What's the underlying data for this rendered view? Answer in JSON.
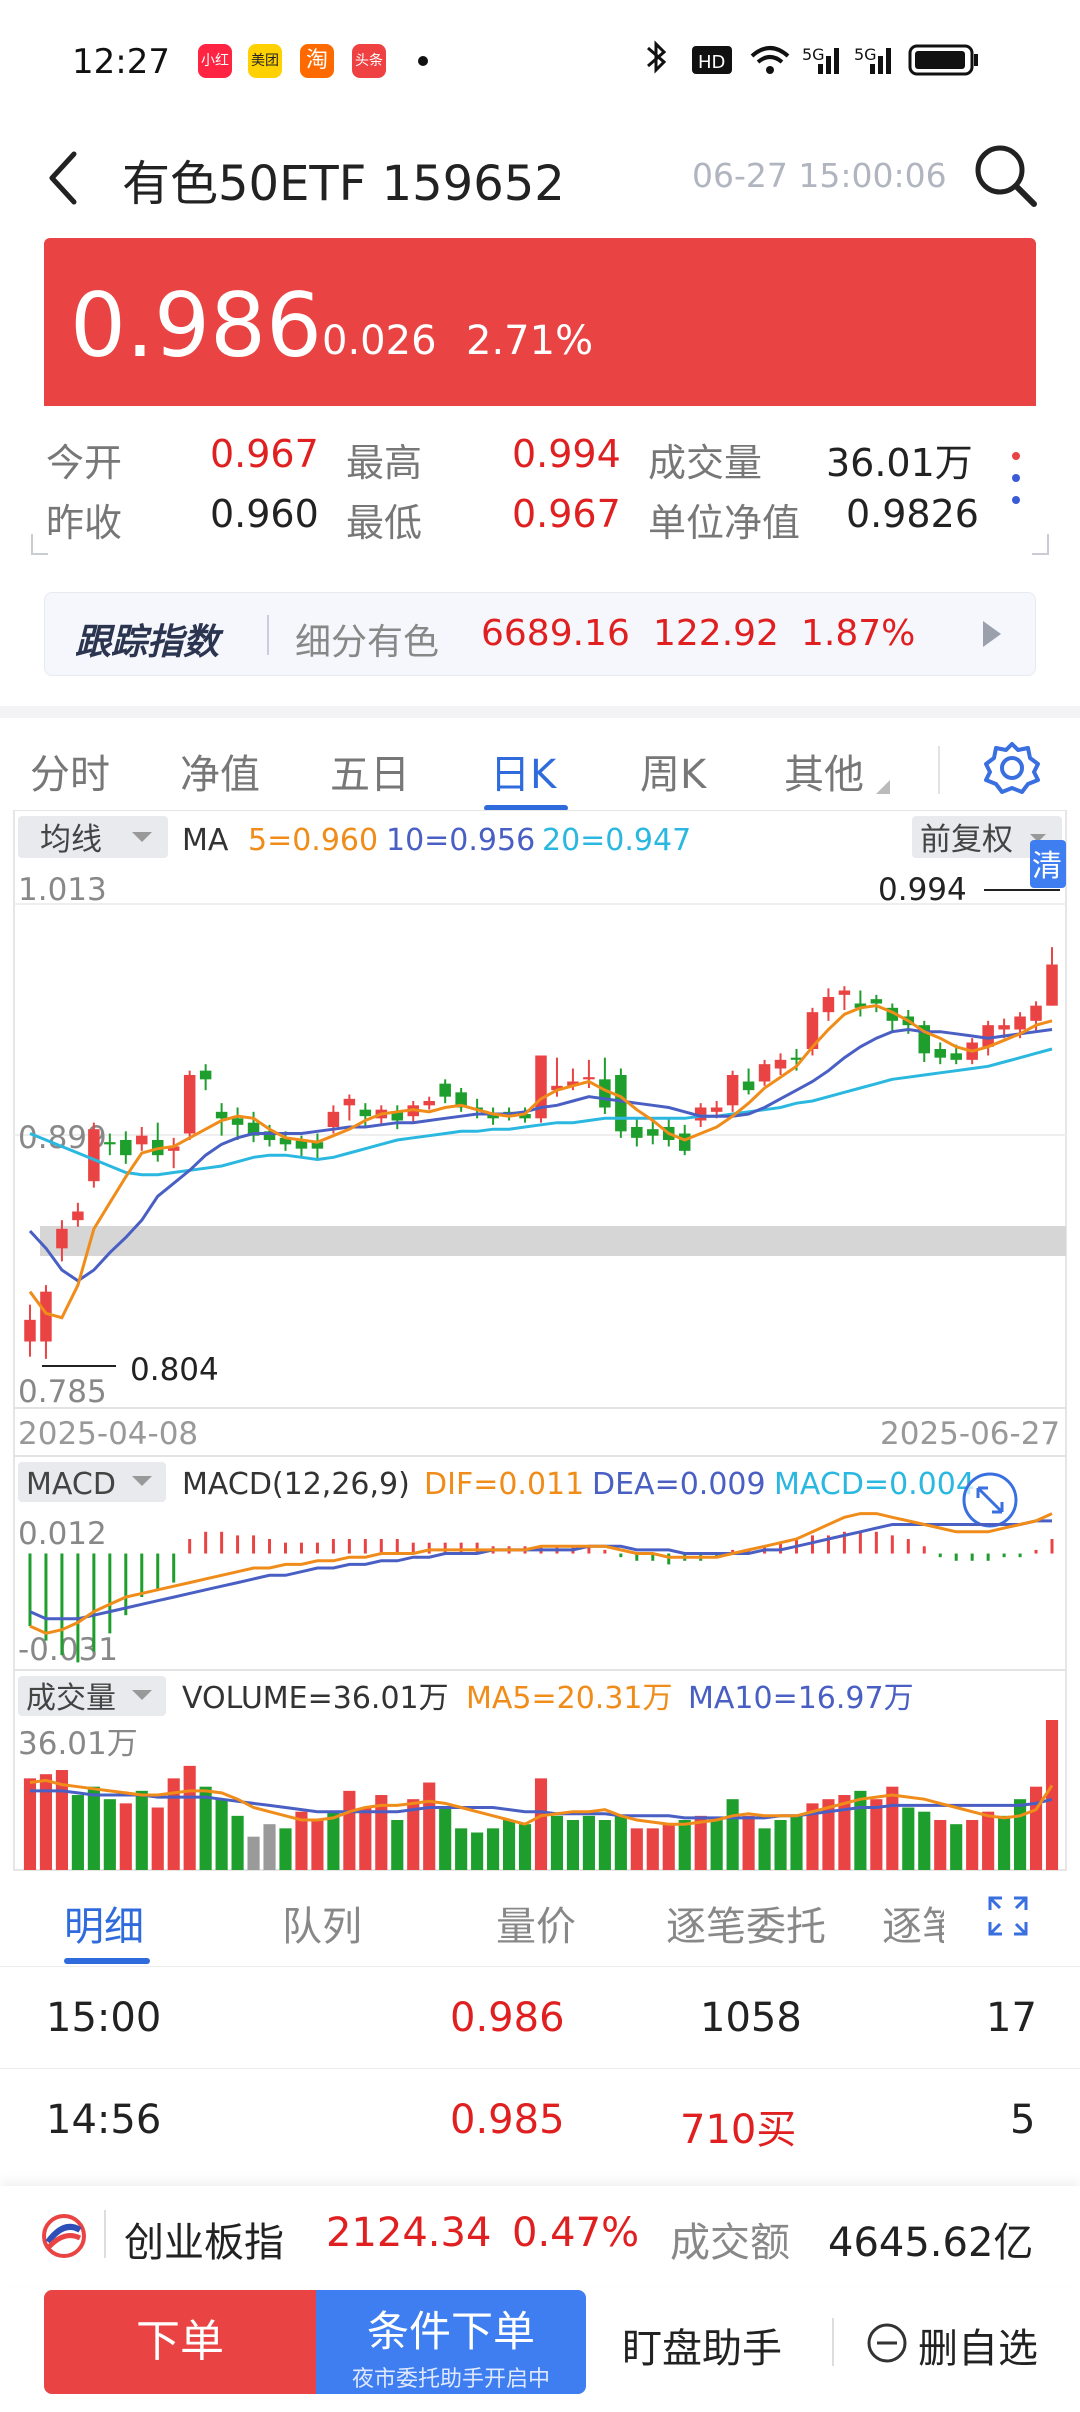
{
  "status_bar": {
    "time": "12:27",
    "apps": [
      "小红书",
      "美团",
      "淘",
      "头条"
    ],
    "icons": [
      "bluetooth-icon",
      "hd-icon",
      "wifi-icon",
      "signal-5g-icon",
      "signal-5g-icon",
      "battery-icon"
    ]
  },
  "header": {
    "title": "有色50ETF 159652",
    "timestamp": "06-27 15:00:06"
  },
  "quote": {
    "price": "0.986",
    "change": "0.026",
    "change_pct": "2.71%",
    "open_label": "今开",
    "open": "0.967",
    "high_label": "最高",
    "high": "0.994",
    "volume_label": "成交量",
    "volume": "36.01万",
    "prev_close_label": "昨收",
    "prev_close": "0.960",
    "low_label": "最低",
    "low": "0.967",
    "nav_label": "单位净值",
    "nav": "0.9826"
  },
  "tracking": {
    "label": "跟踪指数",
    "index_name": "细分有色",
    "index_value": "6689.16",
    "index_change": "122.92",
    "index_pct": "1.87%"
  },
  "tabs": [
    {
      "label": "分时"
    },
    {
      "label": "净值"
    },
    {
      "label": "五日"
    },
    {
      "label": "日K"
    },
    {
      "label": "周K"
    },
    {
      "label": "其他"
    }
  ],
  "kline": {
    "ma_selector": "均线",
    "ma_label": "MA",
    "ma5": "5=0.960",
    "ma10": "10=0.956",
    "ma20": "20=0.947",
    "adjust": "前复权",
    "clear_badge": "清",
    "axis_top": "1.013",
    "axis_mid": "0.899",
    "axis_bottom": "0.785",
    "max_label": "0.994",
    "min_label": "0.804",
    "date_start": "2025-04-08",
    "date_end": "2025-06-27",
    "macd_selector": "MACD",
    "macd_params": "MACD(12,26,9)",
    "dif": "DIF=0.011",
    "dea": "DEA=0.009",
    "macd_val": "MACD=0.004",
    "macd_top": "0.012",
    "macd_bottom": "-0.031",
    "vol_selector": "成交量",
    "vol_label": "VOLUME=36.01万",
    "vol_ma5": "MA5=20.31万",
    "vol_ma10": "MA10=16.97万",
    "vol_top": "36.01万"
  },
  "colors": {
    "up": "#e94443",
    "down": "#1e9e2c",
    "accent": "#2f6bdc",
    "ma5": "#f08c1a",
    "ma10": "#4a5fc4",
    "ma20": "#2bb8e0"
  },
  "chart_data": {
    "type": "candlestick",
    "date_range": [
      "2025-04-08",
      "2025-06-27"
    ],
    "ylim": [
      0.785,
      1.013
    ],
    "candles": [
      {
        "o": 0.812,
        "c": 0.822,
        "h": 0.829,
        "l": 0.805
      },
      {
        "o": 0.812,
        "c": 0.835,
        "h": 0.838,
        "l": 0.804
      },
      {
        "o": 0.855,
        "c": 0.864,
        "h": 0.868,
        "l": 0.849
      },
      {
        "o": 0.868,
        "c": 0.872,
        "h": 0.876,
        "l": 0.865
      },
      {
        "o": 0.886,
        "c": 0.91,
        "h": 0.913,
        "l": 0.883
      },
      {
        "o": 0.904,
        "c": 0.903,
        "h": 0.908,
        "l": 0.898
      },
      {
        "o": 0.905,
        "c": 0.898,
        "h": 0.909,
        "l": 0.894
      },
      {
        "o": 0.903,
        "c": 0.907,
        "h": 0.911,
        "l": 0.9
      },
      {
        "o": 0.905,
        "c": 0.898,
        "h": 0.913,
        "l": 0.895
      },
      {
        "o": 0.9,
        "c": 0.902,
        "h": 0.906,
        "l": 0.892
      },
      {
        "o": 0.908,
        "c": 0.935,
        "h": 0.937,
        "l": 0.905
      },
      {
        "o": 0.937,
        "c": 0.933,
        "h": 0.94,
        "l": 0.928
      },
      {
        "o": 0.918,
        "c": 0.915,
        "h": 0.922,
        "l": 0.907
      },
      {
        "o": 0.915,
        "c": 0.912,
        "h": 0.92,
        "l": 0.905
      },
      {
        "o": 0.913,
        "c": 0.907,
        "h": 0.918,
        "l": 0.904
      },
      {
        "o": 0.909,
        "c": 0.905,
        "h": 0.912,
        "l": 0.902
      },
      {
        "o": 0.906,
        "c": 0.903,
        "h": 0.909,
        "l": 0.9
      },
      {
        "o": 0.905,
        "c": 0.901,
        "h": 0.907,
        "l": 0.897
      },
      {
        "o": 0.904,
        "c": 0.901,
        "h": 0.908,
        "l": 0.896
      },
      {
        "o": 0.911,
        "c": 0.918,
        "h": 0.921,
        "l": 0.908
      },
      {
        "o": 0.921,
        "c": 0.924,
        "h": 0.926,
        "l": 0.914
      },
      {
        "o": 0.919,
        "c": 0.916,
        "h": 0.922,
        "l": 0.911
      },
      {
        "o": 0.915,
        "c": 0.919,
        "h": 0.921,
        "l": 0.912
      },
      {
        "o": 0.918,
        "c": 0.914,
        "h": 0.921,
        "l": 0.91
      },
      {
        "o": 0.916,
        "c": 0.921,
        "h": 0.923,
        "l": 0.913
      },
      {
        "o": 0.921,
        "c": 0.923,
        "h": 0.925,
        "l": 0.919
      },
      {
        "o": 0.931,
        "c": 0.925,
        "h": 0.933,
        "l": 0.922
      },
      {
        "o": 0.927,
        "c": 0.92,
        "h": 0.929,
        "l": 0.918
      },
      {
        "o": 0.92,
        "c": 0.919,
        "h": 0.924,
        "l": 0.915
      },
      {
        "o": 0.917,
        "c": 0.915,
        "h": 0.92,
        "l": 0.912
      },
      {
        "o": 0.918,
        "c": 0.917,
        "h": 0.92,
        "l": 0.914
      },
      {
        "o": 0.917,
        "c": 0.915,
        "h": 0.92,
        "l": 0.913
      },
      {
        "o": 0.915,
        "c": 0.944,
        "h": 0.944,
        "l": 0.913
      },
      {
        "o": 0.928,
        "c": 0.93,
        "h": 0.943,
        "l": 0.925
      },
      {
        "o": 0.93,
        "c": 0.932,
        "h": 0.938,
        "l": 0.928
      },
      {
        "o": 0.933,
        "c": 0.934,
        "h": 0.942,
        "l": 0.929
      },
      {
        "o": 0.933,
        "c": 0.92,
        "h": 0.943,
        "l": 0.917
      },
      {
        "o": 0.935,
        "c": 0.909,
        "h": 0.938,
        "l": 0.906
      },
      {
        "o": 0.911,
        "c": 0.906,
        "h": 0.915,
        "l": 0.902
      },
      {
        "o": 0.91,
        "c": 0.907,
        "h": 0.914,
        "l": 0.903
      },
      {
        "o": 0.911,
        "c": 0.905,
        "h": 0.915,
        "l": 0.902
      },
      {
        "o": 0.908,
        "c": 0.9,
        "h": 0.912,
        "l": 0.898
      },
      {
        "o": 0.914,
        "c": 0.92,
        "h": 0.922,
        "l": 0.911
      },
      {
        "o": 0.918,
        "c": 0.92,
        "h": 0.923,
        "l": 0.915
      },
      {
        "o": 0.921,
        "c": 0.935,
        "h": 0.937,
        "l": 0.918
      },
      {
        "o": 0.932,
        "c": 0.928,
        "h": 0.938,
        "l": 0.926
      },
      {
        "o": 0.932,
        "c": 0.94,
        "h": 0.942,
        "l": 0.93
      },
      {
        "o": 0.938,
        "c": 0.942,
        "h": 0.945,
        "l": 0.935
      },
      {
        "o": 0.943,
        "c": 0.942,
        "h": 0.947,
        "l": 0.937
      },
      {
        "o": 0.947,
        "c": 0.964,
        "h": 0.966,
        "l": 0.944
      },
      {
        "o": 0.964,
        "c": 0.971,
        "h": 0.975,
        "l": 0.96
      },
      {
        "o": 0.972,
        "c": 0.974,
        "h": 0.976,
        "l": 0.965
      },
      {
        "o": 0.968,
        "c": 0.966,
        "h": 0.974,
        "l": 0.962
      },
      {
        "o": 0.97,
        "c": 0.968,
        "h": 0.972,
        "l": 0.964
      },
      {
        "o": 0.966,
        "c": 0.96,
        "h": 0.968,
        "l": 0.955
      },
      {
        "o": 0.962,
        "c": 0.958,
        "h": 0.965,
        "l": 0.954
      },
      {
        "o": 0.958,
        "c": 0.945,
        "h": 0.96,
        "l": 0.941
      },
      {
        "o": 0.947,
        "c": 0.943,
        "h": 0.95,
        "l": 0.94
      },
      {
        "o": 0.945,
        "c": 0.942,
        "h": 0.949,
        "l": 0.94
      },
      {
        "o": 0.942,
        "c": 0.95,
        "h": 0.952,
        "l": 0.94
      },
      {
        "o": 0.948,
        "c": 0.958,
        "h": 0.96,
        "l": 0.944
      },
      {
        "o": 0.956,
        "c": 0.958,
        "h": 0.961,
        "l": 0.952
      },
      {
        "o": 0.956,
        "c": 0.962,
        "h": 0.964,
        "l": 0.952
      },
      {
        "o": 0.96,
        "c": 0.967,
        "h": 0.969,
        "l": 0.955
      },
      {
        "o": 0.967,
        "c": 0.986,
        "h": 0.994,
        "l": 0.967
      }
    ],
    "ma5": [
      0.835,
      0.825,
      0.823,
      0.838,
      0.864,
      0.876,
      0.888,
      0.899,
      0.901,
      0.902,
      0.906,
      0.91,
      0.914,
      0.916,
      0.915,
      0.91,
      0.906,
      0.905,
      0.904,
      0.907,
      0.91,
      0.914,
      0.917,
      0.918,
      0.919,
      0.918,
      0.92,
      0.921,
      0.919,
      0.917,
      0.916,
      0.917,
      0.924,
      0.928,
      0.93,
      0.932,
      0.928,
      0.925,
      0.919,
      0.914,
      0.908,
      0.905,
      0.908,
      0.911,
      0.916,
      0.922,
      0.929,
      0.934,
      0.939,
      0.948,
      0.956,
      0.963,
      0.966,
      0.967,
      0.964,
      0.96,
      0.955,
      0.952,
      0.948,
      0.946,
      0.948,
      0.951,
      0.954,
      0.958,
      0.96
    ],
    "ma10": [
      0.863,
      0.855,
      0.845,
      0.84,
      0.845,
      0.853,
      0.86,
      0.868,
      0.879,
      0.885,
      0.891,
      0.898,
      0.903,
      0.906,
      0.908,
      0.908,
      0.908,
      0.908,
      0.909,
      0.91,
      0.911,
      0.911,
      0.912,
      0.913,
      0.913,
      0.914,
      0.915,
      0.916,
      0.917,
      0.917,
      0.917,
      0.918,
      0.92,
      0.921,
      0.923,
      0.925,
      0.924,
      0.923,
      0.922,
      0.921,
      0.92,
      0.918,
      0.916,
      0.916,
      0.916,
      0.917,
      0.92,
      0.924,
      0.928,
      0.932,
      0.937,
      0.943,
      0.948,
      0.952,
      0.955,
      0.956,
      0.955,
      0.955,
      0.954,
      0.953,
      0.952,
      0.953,
      0.954,
      0.955,
      0.956
    ],
    "ma20": [
      0.908,
      0.905,
      0.902,
      0.899,
      0.896,
      0.893,
      0.89,
      0.889,
      0.889,
      0.89,
      0.891,
      0.892,
      0.893,
      0.895,
      0.897,
      0.898,
      0.898,
      0.897,
      0.896,
      0.897,
      0.899,
      0.901,
      0.903,
      0.905,
      0.906,
      0.907,
      0.908,
      0.909,
      0.909,
      0.91,
      0.91,
      0.911,
      0.912,
      0.913,
      0.913,
      0.914,
      0.915,
      0.915,
      0.915,
      0.915,
      0.915,
      0.915,
      0.916,
      0.916,
      0.917,
      0.918,
      0.919,
      0.92,
      0.922,
      0.923,
      0.925,
      0.927,
      0.929,
      0.931,
      0.933,
      0.934,
      0.935,
      0.936,
      0.937,
      0.938,
      0.939,
      0.941,
      0.943,
      0.945,
      0.947
    ],
    "macd": {
      "ylim": [
        -0.031,
        0.012
      ],
      "dif": [
        -0.02,
        -0.022,
        -0.021,
        -0.019,
        -0.016,
        -0.014,
        -0.012,
        -0.011,
        -0.01,
        -0.009,
        -0.008,
        -0.007,
        -0.006,
        -0.005,
        -0.004,
        -0.004,
        -0.003,
        -0.003,
        -0.002,
        -0.002,
        -0.001,
        -0.001,
        0.0,
        0.0,
        0.0,
        0.001,
        0.001,
        0.001,
        0.001,
        0.001,
        0.001,
        0.001,
        0.002,
        0.002,
        0.002,
        0.002,
        0.002,
        0.001,
        0.0,
        0.0,
        -0.001,
        -0.001,
        -0.001,
        -0.001,
        0.0,
        0.001,
        0.002,
        0.003,
        0.004,
        0.006,
        0.008,
        0.01,
        0.011,
        0.011,
        0.01,
        0.009,
        0.008,
        0.007,
        0.006,
        0.006,
        0.006,
        0.007,
        0.008,
        0.009,
        0.011
      ],
      "dea": [
        -0.016,
        -0.018,
        -0.018,
        -0.018,
        -0.017,
        -0.016,
        -0.015,
        -0.014,
        -0.013,
        -0.012,
        -0.011,
        -0.01,
        -0.009,
        -0.008,
        -0.007,
        -0.006,
        -0.006,
        -0.005,
        -0.004,
        -0.004,
        -0.003,
        -0.003,
        -0.002,
        -0.002,
        -0.001,
        -0.001,
        0.0,
        0.0,
        0.0,
        0.001,
        0.001,
        0.001,
        0.001,
        0.001,
        0.001,
        0.002,
        0.002,
        0.002,
        0.001,
        0.001,
        0.001,
        0.0,
        0.0,
        0.0,
        0.0,
        0.0,
        0.001,
        0.001,
        0.002,
        0.003,
        0.004,
        0.005,
        0.006,
        0.007,
        0.008,
        0.008,
        0.008,
        0.008,
        0.008,
        0.008,
        0.008,
        0.008,
        0.008,
        0.009,
        0.009
      ],
      "hist": [
        -0.02,
        -0.024,
        -0.028,
        -0.03,
        -0.027,
        -0.022,
        -0.017,
        -0.012,
        -0.01,
        -0.008,
        0.004,
        0.006,
        0.006,
        0.005,
        0.005,
        0.004,
        0.003,
        0.003,
        0.003,
        0.004,
        0.004,
        0.004,
        0.004,
        0.004,
        0.003,
        0.003,
        0.003,
        0.003,
        0.003,
        0.002,
        0.002,
        0.002,
        0.002,
        0.002,
        0.002,
        0.002,
        0.001,
        -0.001,
        -0.002,
        -0.002,
        -0.003,
        -0.002,
        -0.002,
        -0.001,
        0.001,
        0.001,
        0.002,
        0.003,
        0.004,
        0.005,
        0.005,
        0.006,
        0.006,
        0.006,
        0.005,
        0.004,
        0.002,
        -0.001,
        -0.002,
        -0.002,
        -0.002,
        -0.001,
        -0.001,
        0.001,
        0.004
      ]
    },
    "volume": {
      "unit": "万",
      "ymax": 36.01,
      "values": [
        22,
        23,
        24,
        18,
        20,
        17,
        16,
        19,
        15,
        22,
        25,
        20,
        17,
        13,
        8,
        11,
        10,
        14,
        12,
        14,
        19,
        15,
        18,
        12,
        17,
        21,
        15,
        10,
        9,
        10,
        12,
        11,
        22,
        13,
        12,
        13,
        12,
        13,
        10,
        10,
        11,
        12,
        13,
        12,
        17,
        13,
        10,
        12,
        13,
        16,
        17,
        18,
        19,
        17,
        20,
        15,
        14,
        12,
        11,
        12,
        14,
        13,
        17,
        20,
        36.01
      ],
      "colors": [
        "r",
        "r",
        "r",
        "g",
        "g",
        "g",
        "r",
        "g",
        "r",
        "r",
        "r",
        "g",
        "g",
        "g",
        "n",
        "n",
        "g",
        "r",
        "r",
        "g",
        "r",
        "r",
        "r",
        "g",
        "r",
        "r",
        "g",
        "g",
        "g",
        "g",
        "g",
        "g",
        "r",
        "g",
        "g",
        "g",
        "g",
        "g",
        "r",
        "r",
        "r",
        "g",
        "r",
        "g",
        "g",
        "r",
        "g",
        "g",
        "g",
        "r",
        "r",
        "r",
        "g",
        "r",
        "r",
        "g",
        "g",
        "r",
        "g",
        "r",
        "r",
        "g",
        "g",
        "r",
        "r"
      ],
      "ma5": [
        21,
        21.5,
        20.5,
        20,
        19.5,
        19,
        18.5,
        18,
        18,
        18.5,
        19,
        19,
        18.5,
        17,
        15,
        14,
        13,
        12,
        12,
        12.5,
        14,
        15,
        15.5,
        15.5,
        16,
        16.5,
        16,
        15,
        14,
        13,
        12,
        11,
        13,
        13.5,
        14,
        14,
        14.5,
        13,
        12,
        11.5,
        11,
        11,
        11.5,
        12,
        13,
        13.5,
        13,
        13,
        13,
        14,
        15,
        16,
        17,
        17.5,
        18,
        17.5,
        17,
        16,
        15,
        14,
        13,
        12.5,
        13,
        14.5,
        20.31
      ],
      "ma10": [
        19,
        19,
        19,
        18.5,
        18,
        18,
        18,
        18,
        17.5,
        17.5,
        17.5,
        17.5,
        17,
        16.5,
        16,
        15.5,
        15,
        14.5,
        14,
        14,
        14,
        14,
        14,
        14,
        14.5,
        15,
        15,
        15,
        15,
        15,
        14.5,
        14,
        14,
        13.5,
        13.5,
        13.5,
        13.5,
        13,
        13,
        13,
        13,
        12.5,
        12.5,
        12.5,
        12.5,
        12.5,
        12.5,
        13,
        13,
        13.5,
        14,
        14.5,
        15,
        15,
        15.5,
        15.5,
        15.5,
        15.5,
        15.5,
        15.5,
        15.5,
        15.5,
        15.5,
        16,
        16.97
      ]
    }
  },
  "detail_tabs": [
    {
      "label": "明细"
    },
    {
      "label": "队列"
    },
    {
      "label": "量价"
    },
    {
      "label": "逐笔委托"
    },
    {
      "label": "逐笔"
    }
  ],
  "trades": [
    {
      "time": "15:00",
      "price": "0.986",
      "vol": "1058",
      "count": "17"
    },
    {
      "time": "14:56",
      "price": "0.985",
      "vol": "710买",
      "count": "5"
    }
  ],
  "index_bar": {
    "name": "创业板指",
    "value": "2124.34",
    "pct": "0.47%",
    "turnover_label": "成交额",
    "turnover": "4645.62亿"
  },
  "actions": {
    "order": "下单",
    "conditional": "条件下单",
    "conditional_sub": "夜市委托助手开启中",
    "assistant": "盯盘助手",
    "remove_fav": "删自选"
  }
}
